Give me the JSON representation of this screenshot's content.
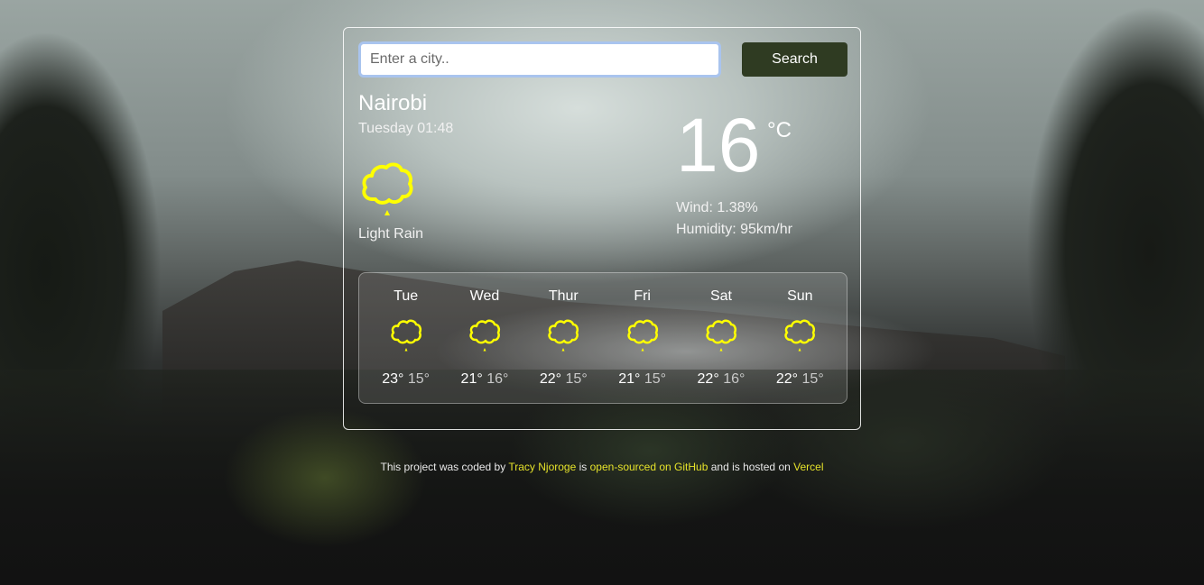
{
  "search": {
    "placeholder": "Enter a city..",
    "button_label": "Search"
  },
  "current": {
    "city": "Nairobi",
    "datetime": "Tuesday 01:48",
    "icon": "rain-cloud-icon",
    "description": "Light Rain",
    "temperature": "16",
    "unit": "°C",
    "wind": "Wind: 1.38%",
    "humidity": "Humidity: 95km/hr"
  },
  "forecast": [
    {
      "day": "Tue",
      "max": "23°",
      "min": "15°",
      "icon": "rain-cloud-icon"
    },
    {
      "day": "Wed",
      "max": "21°",
      "min": "16°",
      "icon": "rain-cloud-icon"
    },
    {
      "day": "Thur",
      "max": "22°",
      "min": "15°",
      "icon": "rain-cloud-icon"
    },
    {
      "day": "Fri",
      "max": "21°",
      "min": "15°",
      "icon": "rain-cloud-icon"
    },
    {
      "day": "Sat",
      "max": "22°",
      "min": "16°",
      "icon": "rain-cloud-icon"
    },
    {
      "day": "Sun",
      "max": "22°",
      "min": "15°",
      "icon": "rain-cloud-icon"
    }
  ],
  "footer": {
    "prefix": "This project was coded by",
    "author_link": "Tracy Njoroge",
    "middle": "is",
    "github_link": "open-sourced on GitHub",
    "suffix": "and is hosted on",
    "host_link": "Vercel"
  },
  "colors": {
    "icon": "#ffff00",
    "link": "#e5e22a",
    "button": "#2f3b22"
  }
}
